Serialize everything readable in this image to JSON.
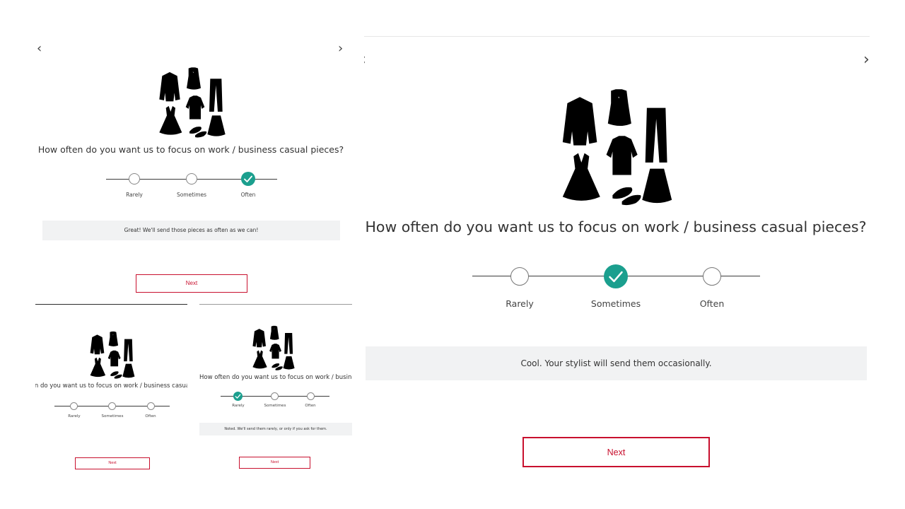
{
  "question": "How often do you want us to focus on work / business casual pieces?",
  "options": [
    "Rarely",
    "Sometimes",
    "Often"
  ],
  "next_label": "Next",
  "accent_color": "#1b9f8e",
  "button_color": "#c8102e",
  "icons": {
    "prev": "chevron-left-icon",
    "next": "chevron-right-icon",
    "selected": "check-icon",
    "illustration": "clothing-illustration"
  },
  "screens": {
    "often": {
      "selected": "Often",
      "message": "Great! We'll send those pieces as often as we can!"
    },
    "none": {
      "selected": ""
    },
    "rarely": {
      "selected": "Rarely",
      "message": "Noted. We'll send them rarely, or only if you ask for them."
    },
    "sometimes": {
      "selected": "Sometimes",
      "message": "Cool. Your stylist will send them occasionally."
    }
  }
}
